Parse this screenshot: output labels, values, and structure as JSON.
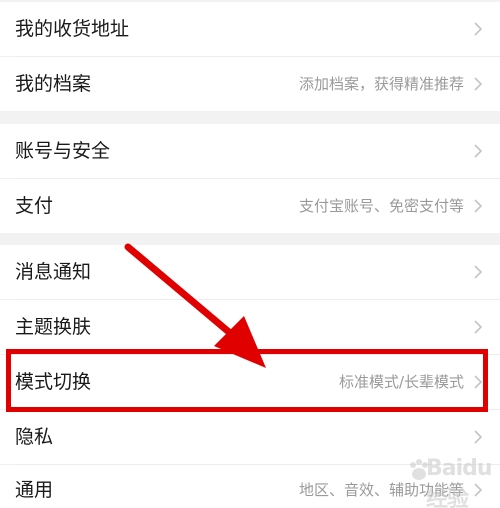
{
  "settings": {
    "rows": [
      {
        "label": "我的收货地址",
        "value": ""
      },
      {
        "label": "我的档案",
        "value": "添加档案，获得精准推荐"
      },
      {
        "label": "账号与安全",
        "value": ""
      },
      {
        "label": "支付",
        "value": "支付宝账号、免密支付等"
      },
      {
        "label": "消息通知",
        "value": ""
      },
      {
        "label": "主题换肤",
        "value": ""
      },
      {
        "label": "模式切换",
        "value": "标准模式/长辈模式"
      },
      {
        "label": "隐私",
        "value": ""
      },
      {
        "label": "通用",
        "value": "地区、音效、辅助功能等"
      }
    ]
  },
  "annotation": {
    "highlight_color": "#e00000",
    "arrow_color": "#e00000",
    "highlighted_item": "模式切换"
  },
  "watermark": {
    "text": "Baidu 经验"
  },
  "colors": {
    "background": "#f2f2f2",
    "row_background": "#ffffff",
    "label_text": "#1a1a1a",
    "secondary_text": "#9a9a9a",
    "chevron": "#c4c4c4"
  },
  "icons": {
    "row_trailing": "chevron-right-icon",
    "watermark_logo": "paw-icon"
  }
}
